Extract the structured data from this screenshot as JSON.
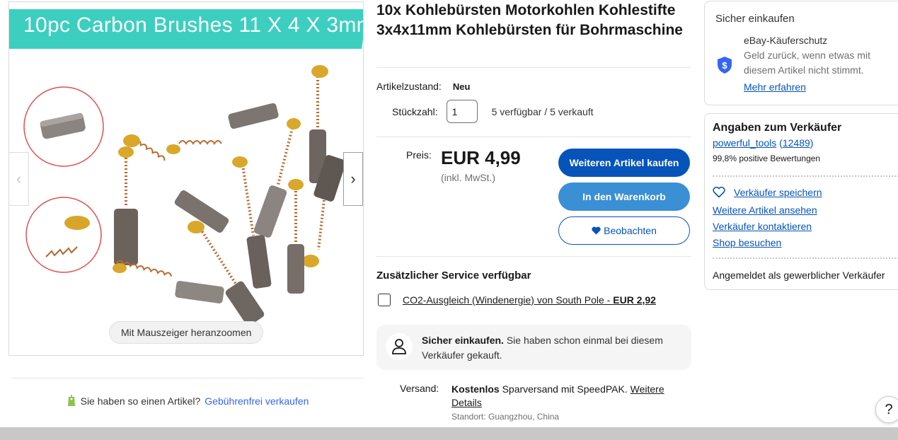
{
  "gallery": {
    "banner_text": "10pc Carbon Brushes 11 X 4 X 3mm",
    "zoom_hint": "Mit Mauszeiger heranzoomen",
    "prev_arrow": "‹",
    "next_arrow": "›"
  },
  "sell": {
    "prompt": "Sie haben so einen Artikel?",
    "link": "Gebührenfrei verkaufen"
  },
  "listing": {
    "title": "10x Kohlebürsten Motorkohlen Kohlestifte 3x4x11mm Kohlebürsten für Bohrmaschine",
    "condition_label": "Artikelzustand:",
    "condition_value": "Neu",
    "quantity_label": "Stückzahl:",
    "quantity_value": "1",
    "availability": "5 verfügbar / 5 verkauft",
    "price_label": "Preis:",
    "price": "EUR 4,99",
    "price_note": "(inkl. MwSt.)"
  },
  "actions": {
    "buy": "Weiteren Artikel kaufen",
    "cart": "In den Warenkorb",
    "watch": "Beobachten"
  },
  "service": {
    "title": "Zusätzlicher Service verfügbar",
    "option_text": "CO2-Ausgleich (Windenergie) von South Pole - ",
    "option_price": "EUR 2,92"
  },
  "secure_notice": {
    "bold": "Sicher einkaufen.",
    "text": " Sie haben schon einmal bei diesem Verkäufer gekauft."
  },
  "shipping": {
    "label": "Versand:",
    "bold": "Kostenlos",
    "text": " Sparversand mit SpeedPAK. ",
    "more": "Weitere Details",
    "location": "Standort: Guangzhou, China"
  },
  "secure_card": {
    "heading": "Sicher einkaufen",
    "protection_title": "eBay-Käuferschutz",
    "protection_desc": "Geld zurück, wenn etwas mit diesem Artikel nicht stimmt.",
    "learn_more": "Mehr erfahren"
  },
  "seller": {
    "title": "Angaben zum Verkäufer",
    "name": "powerful_tools",
    "paren_open": " (",
    "rating_count": "12489",
    "paren_close": ")",
    "feedback": "99,8% positive Bewertungen",
    "save": "Verkäufer speichern",
    "more_items": "Weitere Artikel ansehen",
    "contact": "Verkäufer kontaktieren",
    "shop": "Shop besuchen",
    "business": "Angemeldet als gewerblicher Verkäufer"
  },
  "help": {
    "label": "?"
  },
  "colors": {
    "primary_blue": "#0654ba",
    "secondary_blue": "#3b8fd4",
    "link_blue": "#3665f3",
    "banner_teal": "#3ccfc0",
    "shield_blue": "#3665f3"
  },
  "icons": {
    "tag": "price-tag-icon",
    "shield": "shield-dollar-icon",
    "heart": "heart-icon",
    "person": "person-icon",
    "help": "question-icon"
  }
}
